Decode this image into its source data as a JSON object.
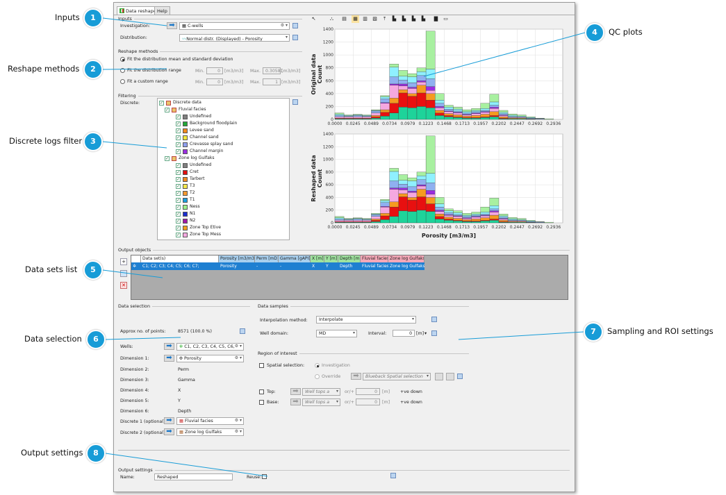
{
  "tabs": [
    "Data reshaper",
    "Help"
  ],
  "callouts": [
    {
      "n": "1",
      "text": "Inputs"
    },
    {
      "n": "2",
      "text": "Reshape methods"
    },
    {
      "n": "3",
      "text": "Discrete logs filter"
    },
    {
      "n": "4",
      "text": "QC plots"
    },
    {
      "n": "5",
      "text": "Data sets list"
    },
    {
      "n": "6",
      "text": "Data selection"
    },
    {
      "n": "7",
      "text": "Sampling and ROI settings"
    },
    {
      "n": "8",
      "text": "Output settings"
    }
  ],
  "inputs": {
    "title": "Inputs",
    "investigation_label": "Investigation:",
    "investigation_value": "C-wells",
    "distribution_label": "Distribution:",
    "distribution_value": "Normal distr. (Displayed) - Porosity"
  },
  "reshape": {
    "title": "Reshape methods",
    "opt1": "Fit the distribution mean and standard deviation",
    "opt2": "Fit the distribution range",
    "opt3": "Fit a custom range",
    "min_label": "Min.",
    "max_label": "Max.",
    "min1": "0",
    "max1": "0.30581",
    "min2": "0",
    "max2": "1",
    "unit": "[m3/m3]"
  },
  "filtering": {
    "title": "Filtering",
    "discrete_label": "Discrete:",
    "tree": [
      {
        "label": "Discrete data",
        "level": 0,
        "color": ""
      },
      {
        "label": "Fluvial facies",
        "level": 1,
        "color": ""
      },
      {
        "label": "Undefined",
        "level": 2,
        "color": "#808080"
      },
      {
        "label": "Background floodplain",
        "level": 2,
        "color": "#22a838"
      },
      {
        "label": "Levee sand",
        "level": 2,
        "color": "#f28a1c"
      },
      {
        "label": "Channel sand",
        "level": 2,
        "color": "#f0e83a"
      },
      {
        "label": "Crevasse splay sand",
        "level": 2,
        "color": "#8fa0f0"
      },
      {
        "label": "Channel margin",
        "level": 2,
        "color": "#9a2ee0"
      },
      {
        "label": "Zone log Gulfaks",
        "level": 1,
        "color": ""
      },
      {
        "label": "Undefined",
        "level": 2,
        "color": "#808080"
      },
      {
        "label": "Cret",
        "level": 2,
        "color": "#e01010"
      },
      {
        "label": "Tarbert",
        "level": 2,
        "color": "#f08a20"
      },
      {
        "label": "T3",
        "level": 2,
        "color": "#f5e84a"
      },
      {
        "label": "T2",
        "level": 2,
        "color": "#f59a30"
      },
      {
        "label": "T1",
        "level": 2,
        "color": "#1ba0e0"
      },
      {
        "label": "Ness",
        "level": 2,
        "color": "#9bf08a"
      },
      {
        "label": "N1",
        "level": 2,
        "color": "#1a30d0"
      },
      {
        "label": "N2",
        "level": 2,
        "color": "#a01aa8"
      },
      {
        "label": "Zone Top Etive",
        "level": 2,
        "color": "#f0a020"
      },
      {
        "label": "Zone Top Mess",
        "level": 2,
        "color": "#f5a8e0"
      }
    ]
  },
  "chart_data": [
    {
      "type": "bar",
      "title": "",
      "ylabel": "Original data\nCount",
      "xlabel": "",
      "ylim": [
        0,
        1400
      ],
      "yticks": [
        "1400",
        "1200",
        "1000",
        "800",
        "600",
        "400",
        "200",
        "0"
      ],
      "xticks": [
        "0.0000",
        "0.0245",
        "0.0489",
        "0.0734",
        "0.0979",
        "0.1223",
        "0.1468",
        "0.1713",
        "0.1957",
        "0.2202",
        "0.2447",
        "0.2692",
        "0.2936"
      ],
      "xlim": [
        0,
        0.306
      ],
      "bin_width": 0.01223,
      "bins_start": [
        0.0,
        0.01223,
        0.02446,
        0.03669,
        0.04892,
        0.06115,
        0.07338,
        0.08561,
        0.09784,
        0.11007,
        0.1223,
        0.13453,
        0.14676,
        0.15899,
        0.17122,
        0.18345,
        0.19568,
        0.20791,
        0.22014,
        0.23237,
        0.2446,
        0.25683,
        0.26906,
        0.28129
      ],
      "series": [
        {
          "color": "#1ed39a",
          "values": [
            10,
            10,
            10,
            10,
            20,
            50,
            100,
            190,
            180,
            200,
            180,
            60,
            40,
            30,
            20,
            20,
            30,
            40,
            10,
            10,
            10,
            5,
            0,
            0
          ]
        },
        {
          "color": "#e81010",
          "values": [
            10,
            10,
            10,
            10,
            20,
            60,
            150,
            220,
            180,
            210,
            120,
            40,
            20,
            10,
            10,
            10,
            10,
            20,
            10,
            5,
            0,
            0,
            0,
            0
          ]
        },
        {
          "color": "#f59a20",
          "values": [
            0,
            0,
            0,
            0,
            20,
            40,
            80,
            50,
            40,
            120,
            100,
            40,
            30,
            30,
            20,
            30,
            40,
            60,
            20,
            10,
            10,
            0,
            0,
            0
          ]
        },
        {
          "color": "#f5a8e0",
          "values": [
            20,
            20,
            20,
            20,
            40,
            100,
            200,
            60,
            80,
            50,
            50,
            40,
            30,
            30,
            20,
            30,
            30,
            50,
            20,
            10,
            10,
            5,
            0,
            0
          ]
        },
        {
          "color": "#9a2ee0",
          "values": [
            0,
            0,
            0,
            0,
            0,
            10,
            20,
            30,
            20,
            20,
            60,
            20,
            10,
            10,
            10,
            10,
            10,
            20,
            10,
            0,
            0,
            0,
            0,
            0
          ]
        },
        {
          "color": "#8fb0f0",
          "values": [
            20,
            10,
            20,
            10,
            30,
            60,
            110,
            60,
            70,
            80,
            120,
            50,
            30,
            20,
            20,
            20,
            20,
            30,
            20,
            10,
            10,
            10,
            10,
            0
          ]
        },
        {
          "color": "#8ff0ff",
          "values": [
            20,
            10,
            10,
            10,
            10,
            30,
            150,
            60,
            90,
            60,
            150,
            50,
            30,
            30,
            20,
            20,
            30,
            50,
            20,
            20,
            10,
            10,
            5,
            0
          ]
        },
        {
          "color": "#a8f0a0",
          "values": [
            20,
            10,
            10,
            10,
            10,
            20,
            50,
            90,
            50,
            60,
            590,
            100,
            30,
            30,
            30,
            30,
            80,
            120,
            30,
            20,
            20,
            10,
            5,
            10
          ]
        }
      ]
    },
    {
      "type": "bar",
      "title": "",
      "ylabel": "Reshaped data\nCount",
      "xlabel": "Porosity [m3/m3]",
      "ylim": [
        0,
        1400
      ],
      "yticks": [
        "1400",
        "1200",
        "1000",
        "800",
        "600",
        "400",
        "200",
        "0"
      ],
      "xticks": [
        "0.0000",
        "0.0245",
        "0.0489",
        "0.0734",
        "0.0979",
        "0.1223",
        "0.1468",
        "0.1713",
        "0.1957",
        "0.2202",
        "0.2447",
        "0.2692",
        "0.2936"
      ],
      "xlim": [
        0,
        0.306
      ],
      "bin_width": 0.01223,
      "bins_start": [
        0.0,
        0.01223,
        0.02446,
        0.03669,
        0.04892,
        0.06115,
        0.07338,
        0.08561,
        0.09784,
        0.11007,
        0.1223,
        0.13453,
        0.14676,
        0.15899,
        0.17122,
        0.18345,
        0.19568,
        0.20791,
        0.22014,
        0.23237,
        0.2446,
        0.25683,
        0.26906,
        0.28129
      ],
      "series": [
        {
          "color": "#1ed39a",
          "values": [
            10,
            10,
            10,
            10,
            20,
            50,
            100,
            190,
            180,
            200,
            180,
            60,
            40,
            30,
            20,
            20,
            30,
            40,
            10,
            10,
            10,
            5,
            0,
            0
          ]
        },
        {
          "color": "#e81010",
          "values": [
            10,
            10,
            10,
            10,
            20,
            60,
            150,
            220,
            180,
            210,
            120,
            40,
            20,
            10,
            10,
            10,
            10,
            20,
            10,
            5,
            0,
            0,
            0,
            0
          ]
        },
        {
          "color": "#f59a20",
          "values": [
            0,
            0,
            0,
            0,
            20,
            40,
            80,
            50,
            40,
            120,
            100,
            40,
            30,
            30,
            20,
            30,
            40,
            60,
            20,
            10,
            10,
            0,
            0,
            0
          ]
        },
        {
          "color": "#f5a8e0",
          "values": [
            20,
            20,
            20,
            20,
            40,
            100,
            200,
            60,
            80,
            50,
            50,
            40,
            30,
            30,
            20,
            30,
            30,
            50,
            20,
            10,
            10,
            5,
            0,
            0
          ]
        },
        {
          "color": "#9a2ee0",
          "values": [
            0,
            0,
            0,
            0,
            0,
            10,
            20,
            30,
            20,
            20,
            60,
            20,
            10,
            10,
            10,
            10,
            10,
            20,
            10,
            0,
            0,
            0,
            0,
            0
          ]
        },
        {
          "color": "#8fb0f0",
          "values": [
            20,
            10,
            20,
            10,
            30,
            60,
            110,
            60,
            70,
            80,
            120,
            50,
            30,
            20,
            20,
            20,
            20,
            30,
            20,
            10,
            10,
            10,
            10,
            0
          ]
        },
        {
          "color": "#8ff0ff",
          "values": [
            20,
            10,
            10,
            10,
            10,
            30,
            150,
            60,
            90,
            60,
            150,
            50,
            30,
            30,
            20,
            20,
            30,
            50,
            20,
            20,
            10,
            10,
            5,
            0
          ]
        },
        {
          "color": "#a8f0a0",
          "values": [
            20,
            10,
            10,
            10,
            10,
            20,
            50,
            90,
            50,
            60,
            590,
            100,
            30,
            30,
            30,
            30,
            80,
            120,
            30,
            20,
            20,
            10,
            5,
            10
          ]
        }
      ]
    }
  ],
  "output_objects": {
    "title": "Output objects",
    "headers": [
      {
        "label": "Data set(s)",
        "color": "#ffffff"
      },
      {
        "label": "Porosity [m3/m3]",
        "color": "#a8cfee"
      },
      {
        "label": "Perm [mD]",
        "color": "#a8cfee"
      },
      {
        "label": "Gamma [gAPI]",
        "color": "#a8cfee"
      },
      {
        "label": "X [m]",
        "color": "#9fe39f"
      },
      {
        "label": "Y [m]",
        "color": "#9fe39f"
      },
      {
        "label": "Depth [m]",
        "color": "#9fe39f"
      },
      {
        "label": "Fluvial facies",
        "color": "#f5a8b8"
      },
      {
        "label": "Zone log Gulfaks",
        "color": "#f5a8b8"
      }
    ],
    "row": [
      "C1; C2; C3; C4; C5; C6; C7;",
      "Porosity",
      "-",
      "-",
      "X",
      "Y",
      "Depth",
      "Fluvial facies",
      "Zone log Gulfaks"
    ]
  },
  "data_selection": {
    "title": "Data selection",
    "approx_label": "Approx no. of points:",
    "approx_value": "8571 (100.0 %)",
    "wells_label": "Wells:",
    "wells_value": "C1, C2, C3, C4, C5, C6, C7",
    "dim1_label": "Dimension 1:",
    "dim1_value": "Porosity",
    "dims": [
      {
        "label": "Dimension 2:",
        "value": "Perm"
      },
      {
        "label": "Dimension 3:",
        "value": "Gamma"
      },
      {
        "label": "Dimension 4:",
        "value": "X"
      },
      {
        "label": "Dimension 5:",
        "value": "Y"
      },
      {
        "label": "Dimension 6:",
        "value": "Depth"
      }
    ],
    "disc1_label": "Discrete 1 (optional):",
    "disc1_value": "Fluvial facies",
    "disc2_label": "Discrete 2 (optional):",
    "disc2_value": "Zone log Gulfaks"
  },
  "data_samples": {
    "title": "Data samples",
    "interp_label": "Interpolation method:",
    "interp_value": "Interpolate",
    "domain_label": "Well domain:",
    "domain_value": "MD",
    "interval_label": "Interval:",
    "interval_value": "0",
    "interval_unit": "[m]"
  },
  "roi": {
    "title": "Region of interest",
    "spatial_label": "Spatial selection:",
    "investigation": "Investigation",
    "override": "Override",
    "spatial_value": "Blueback Spatial selection",
    "top_label": "Top:",
    "base_label": "Base:",
    "tops_value": "Well tops a",
    "ortoggle": "or/+",
    "zero": "0",
    "unit": "[m]",
    "ve_down": "+ve down"
  },
  "output_settings": {
    "title": "Output settings",
    "name_label": "Name:",
    "name_value": "Reshaped",
    "reuse_label": "Reuse:"
  }
}
